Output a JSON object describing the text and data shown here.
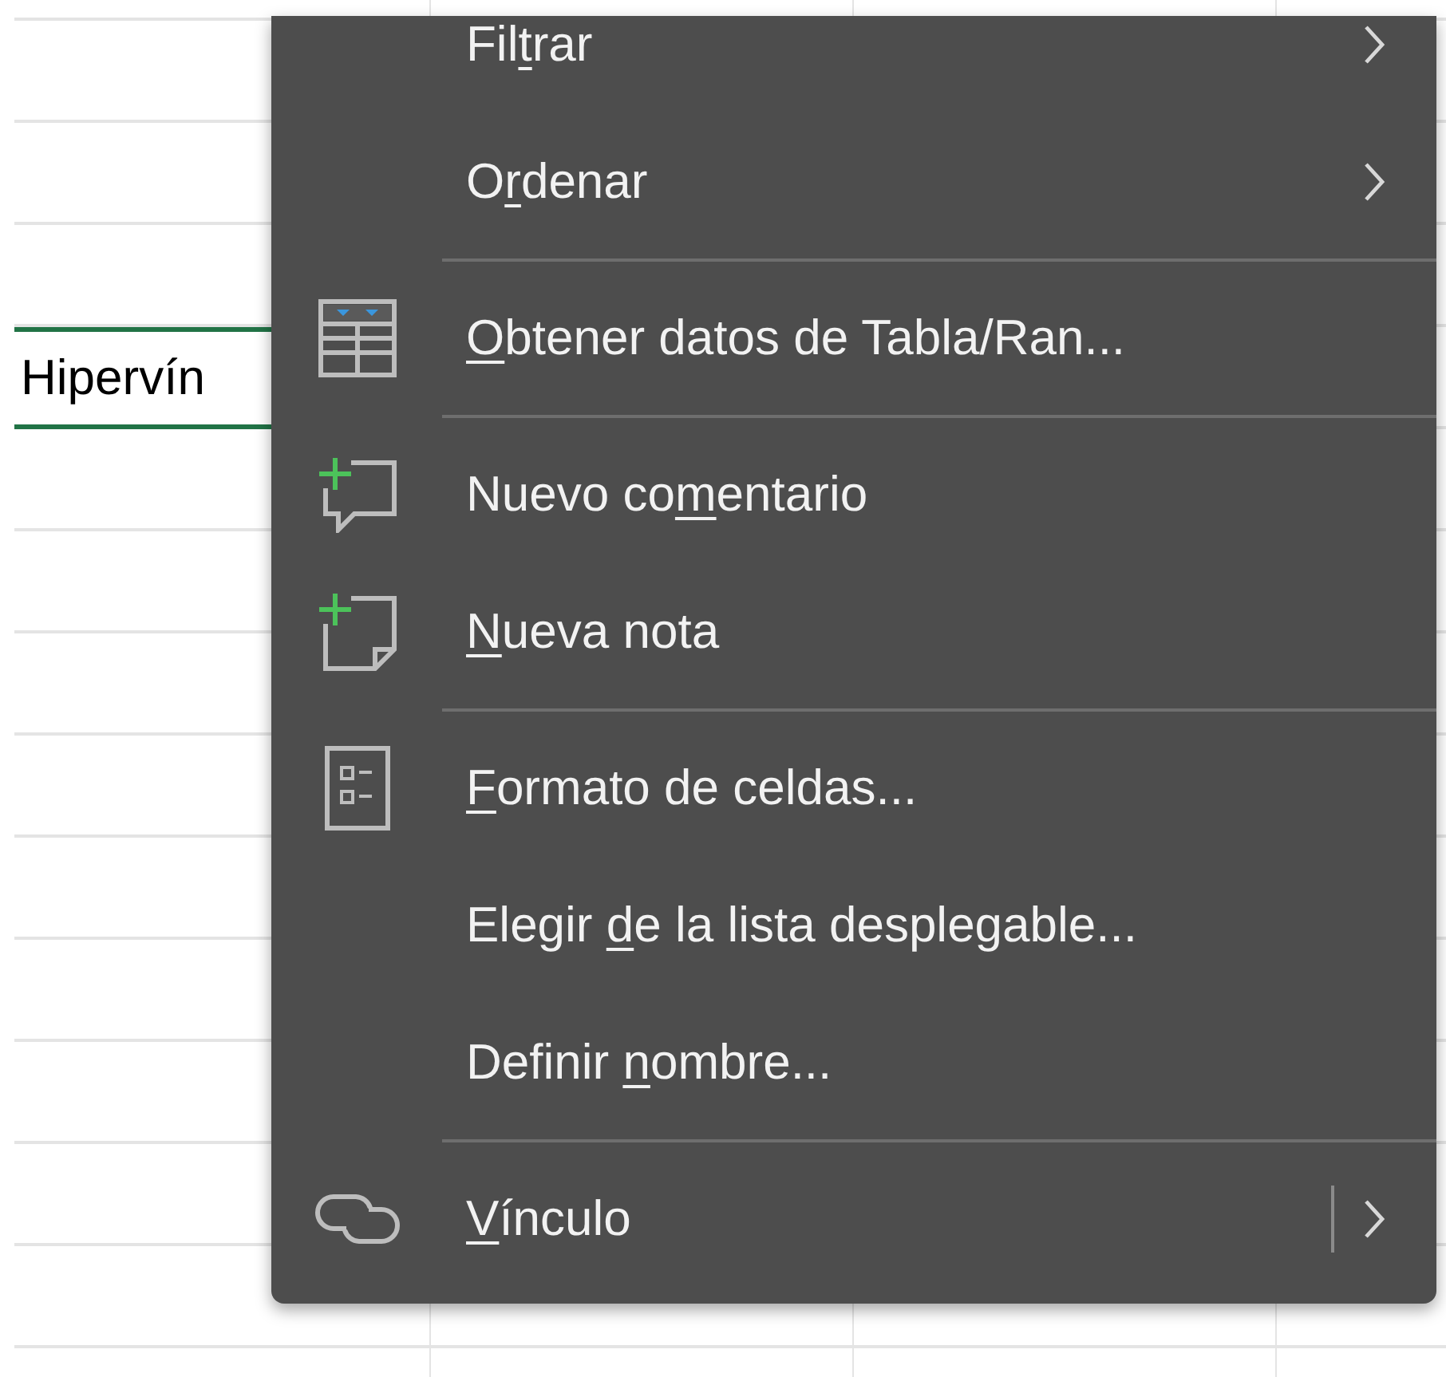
{
  "sheet": {
    "cell": {
      "text": "Hipervín",
      "selected": true
    }
  },
  "context_menu": {
    "items": [
      {
        "kind": "submenu",
        "label": {
          "before": "Fil",
          "key": "t",
          "after": "rar"
        }
      },
      {
        "kind": "submenu",
        "label": {
          "before": "O",
          "key": "r",
          "after": "denar"
        }
      },
      {
        "kind": "separator"
      },
      {
        "kind": "icon",
        "label": {
          "key": "O",
          "after": "btener datos de Tabla/Ran..."
        }
      },
      {
        "kind": "separator"
      },
      {
        "kind": "icon",
        "label": {
          "before": "Nuevo co",
          "key": "m",
          "after": "entario"
        }
      },
      {
        "kind": "icon",
        "label": {
          "key": "N",
          "after": "ueva nota"
        }
      },
      {
        "kind": "separator"
      },
      {
        "kind": "icon",
        "label": {
          "key": "F",
          "after": "ormato de celdas..."
        }
      },
      {
        "kind": "plain",
        "label": {
          "before": "Elegir ",
          "key": "d",
          "after": "e la lista desplegable..."
        }
      },
      {
        "kind": "plain",
        "label": {
          "before": "Definir ",
          "key": "n",
          "after": "ombre..."
        }
      },
      {
        "kind": "separator"
      },
      {
        "kind": "split",
        "label": {
          "key": "V",
          "after": "ínculo"
        }
      }
    ]
  }
}
